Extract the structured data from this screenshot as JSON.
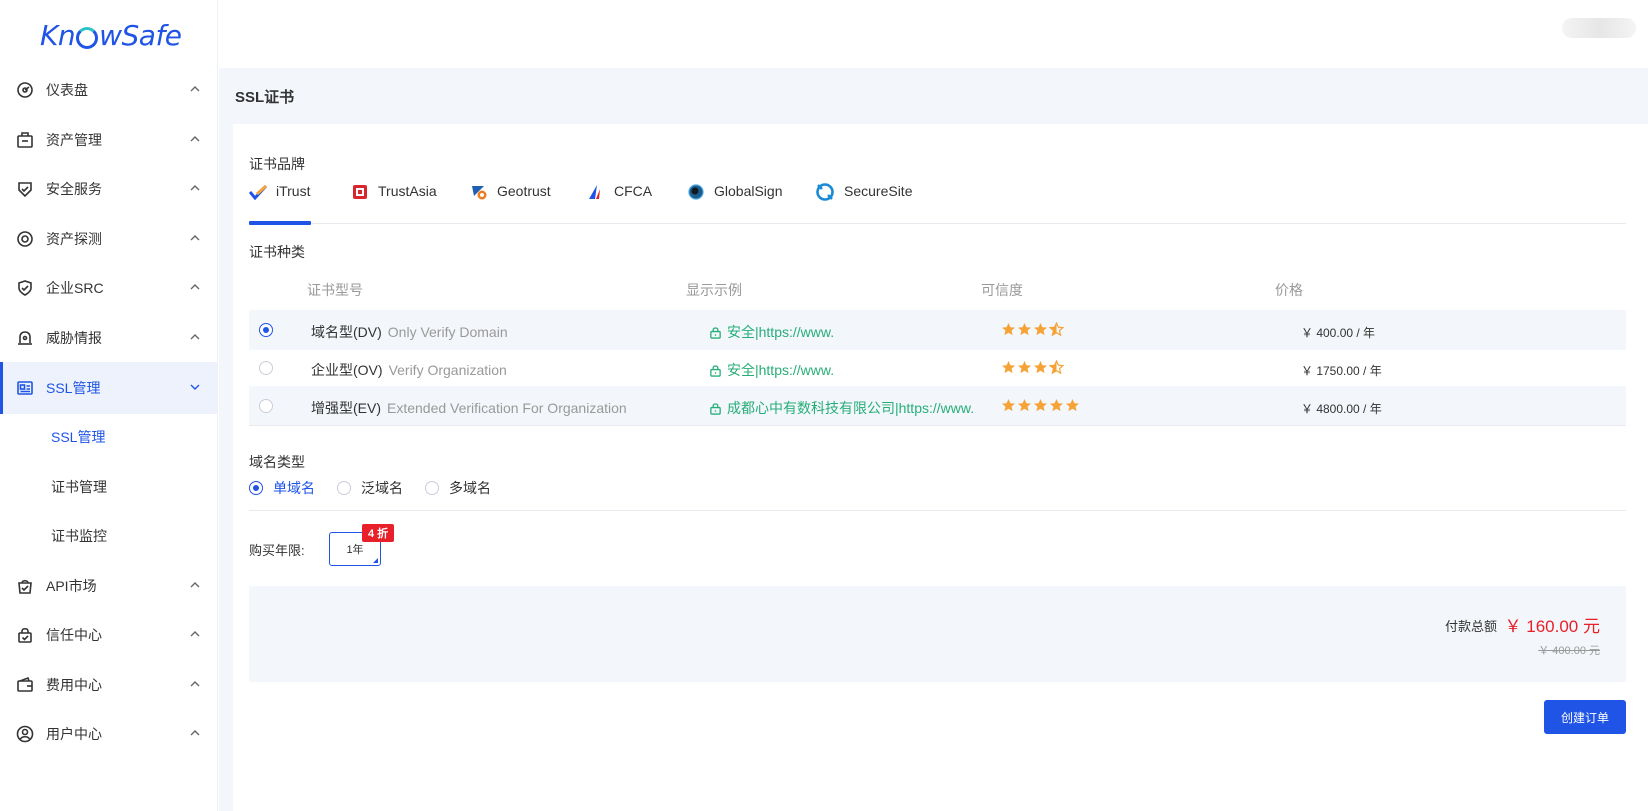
{
  "app": {
    "logo_text_a": "Kn",
    "logo_text_b": "wSafe",
    "brand_color": "#1f54e6"
  },
  "sidebar": {
    "items": [
      {
        "label": "仪表盘",
        "icon": "dashboard-icon"
      },
      {
        "label": "资产管理",
        "icon": "briefcase-icon"
      },
      {
        "label": "安全服务",
        "icon": "shield-check-icon"
      },
      {
        "label": "资产探测",
        "icon": "radar-icon"
      },
      {
        "label": "企业SRC",
        "icon": "shield-badge-icon"
      },
      {
        "label": "威胁情报",
        "icon": "alarm-icon"
      },
      {
        "label": "SSL管理",
        "icon": "certificate-icon",
        "active": true
      },
      {
        "label": "API市场",
        "icon": "shopping-bag-icon"
      },
      {
        "label": "信任中心",
        "icon": "lock-bag-icon"
      },
      {
        "label": "费用中心",
        "icon": "wallet-icon"
      },
      {
        "label": "用户中心",
        "icon": "user-circle-icon"
      }
    ],
    "sub_items": [
      {
        "label": "SSL管理",
        "active": true
      },
      {
        "label": "证书管理"
      },
      {
        "label": "证书监控"
      }
    ]
  },
  "page": {
    "title": "SSL证书"
  },
  "brand_section": {
    "label": "证书品牌",
    "tabs": [
      {
        "label": "iTrust",
        "icon": "itrust-icon",
        "active": true
      },
      {
        "label": "TrustAsia",
        "icon": "trustasia-icon"
      },
      {
        "label": "Geotrust",
        "icon": "geotrust-icon"
      },
      {
        "label": "CFCA",
        "icon": "cfca-icon"
      },
      {
        "label": "GlobalSign",
        "icon": "globalsign-icon"
      },
      {
        "label": "SecureSite",
        "icon": "securesite-icon"
      }
    ]
  },
  "type_section": {
    "label": "证书种类",
    "headers": {
      "model": "证书型号",
      "example": "显示示例",
      "trust": "可信度",
      "price": "价格"
    },
    "rows": [
      {
        "model": "域名型(DV)",
        "model_sub": "Only Verify Domain",
        "example": "安全|https://www.",
        "rating": 3.5,
        "price": "￥ 400.00  / 年",
        "selected": true
      },
      {
        "model": "企业型(OV)",
        "model_sub": "Verify Organization",
        "example": "安全|https://www.",
        "rating": 3.5,
        "price": "￥ 1750.00  / 年",
        "selected": false
      },
      {
        "model": "增强型(EV)",
        "model_sub": "Extended Verification For Organization",
        "example": "成都心中有数科技有限公司|https://www.",
        "rating": 5,
        "price": "￥ 4800.00  / 年",
        "selected": false
      }
    ]
  },
  "domain_type": {
    "label": "域名类型",
    "options": [
      {
        "label": "单域名",
        "selected": true
      },
      {
        "label": "泛域名",
        "selected": false
      },
      {
        "label": "多域名",
        "selected": false
      }
    ]
  },
  "duration": {
    "label": "购买年限:",
    "value": "1年",
    "discount": "4 折"
  },
  "summary": {
    "total_label": "付款总额",
    "total_value": "￥ 160.00 元",
    "original_value": "￥ 400.00 元"
  },
  "actions": {
    "create_order": "创建订单"
  },
  "colors": {
    "accent": "#1f54e6",
    "star": "#f5a236",
    "example_green": "#27ae78",
    "price_red": "#e8202a"
  }
}
